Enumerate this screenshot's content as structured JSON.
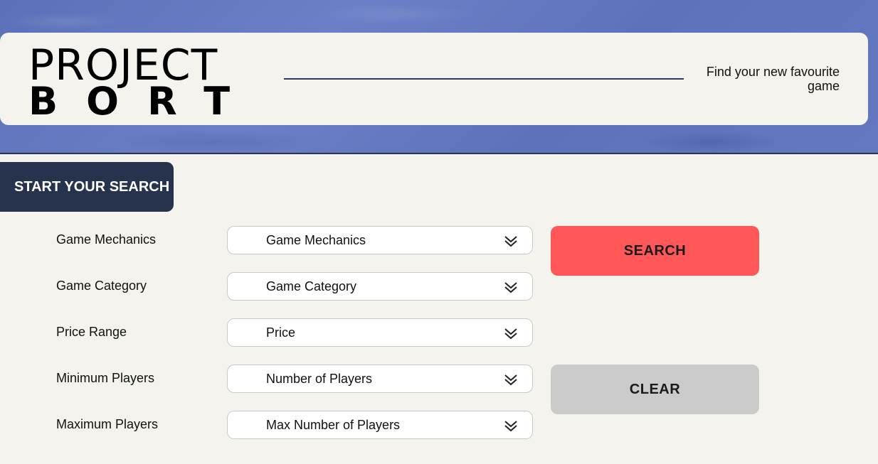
{
  "header": {
    "logo_top": "PROJECT",
    "logo_bottom": "BORT",
    "tagline": "Find your new favourite game"
  },
  "search": {
    "tab_label": "START YOUR SEARCH",
    "filters": [
      {
        "label": "Game Mechanics",
        "value": "Game Mechanics"
      },
      {
        "label": "Game Category",
        "value": "Game Category"
      },
      {
        "label": "Price Range",
        "value": "Price"
      },
      {
        "label": "Minimum Players",
        "value": "Number of Players"
      },
      {
        "label": "Maximum Players",
        "value": "Max Number of Players"
      }
    ],
    "search_button": "SEARCH",
    "clear_button": "CLEAR"
  },
  "colors": {
    "accent_search": "#ff5757",
    "tab_bg": "#27324d",
    "clear_bg": "#cbcbcb"
  },
  "icons": [
    "chevron-double-down-icon"
  ]
}
